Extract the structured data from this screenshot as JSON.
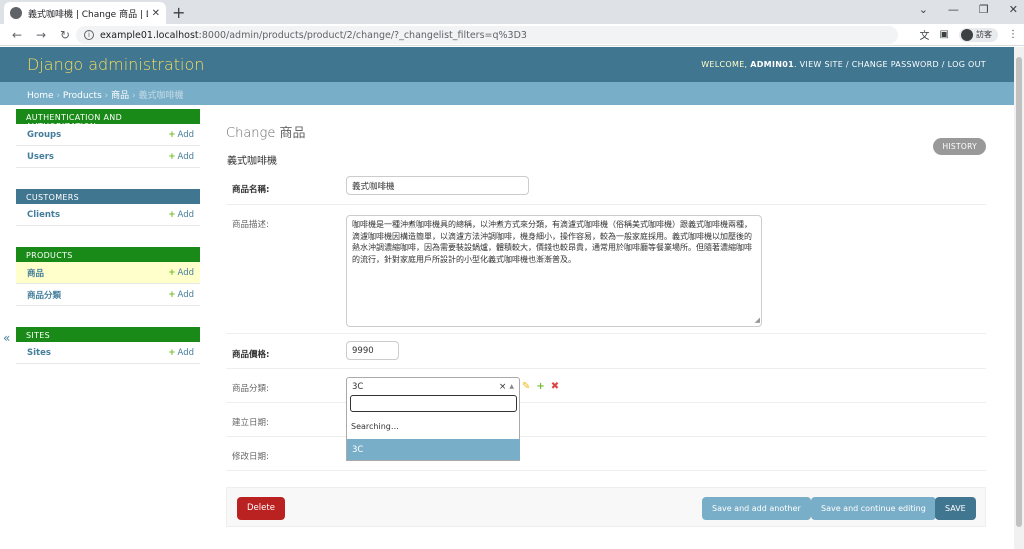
{
  "browser": {
    "tab_title": "義式咖啡機 | Change 商品 | Djan",
    "tab_close": "✕",
    "new_tab": "+",
    "url_host": "example01.localhost",
    "url_rest": ":8000/admin/products/product/2/change/?_changelist_filters=q%3D3",
    "profile_label": "訪客"
  },
  "header": {
    "brand": "Django administration",
    "welcome": "WELCOME, ",
    "username": "ADMIN01",
    "links": ". VIEW SITE / CHANGE PASSWORD / LOG OUT"
  },
  "breadcrumbs": {
    "home": "Home",
    "app": "Products",
    "model": "商品",
    "current": "義式咖啡機",
    "sep": " › "
  },
  "sidebar": {
    "add_label": "Add",
    "modules": [
      {
        "caption": "AUTHENTICATION AND AUTHORIZATION",
        "rows": [
          "Groups",
          "Users"
        ]
      },
      {
        "caption": "CUSTOMERS",
        "rows": [
          "Clients"
        ]
      },
      {
        "caption": "PRODUCTS",
        "rows": [
          "商品",
          "商品分類"
        ]
      },
      {
        "caption": "SITES",
        "rows": [
          "Sites"
        ]
      }
    ],
    "toggle": "«"
  },
  "content": {
    "page_title": "Change 商品",
    "object_title": "義式咖啡機",
    "history": "HISTORY",
    "fields": {
      "name_label": "商品名稱:",
      "name_value": "義式咖啡機",
      "desc_label": "商品描述:",
      "desc_value": "咖啡機是一種沖煮咖啡機具的總稱，以沖煮方式來分類，有滴濾式咖啡機（俗稱美式咖啡機）跟義式咖啡機兩種，滴濾咖啡機因構造簡單，以滴濾方法沖調咖啡，機身細小，操作容易，較為一般家庭採用。義式咖啡機以加壓後的熱水沖調濃縮咖啡，因為需要裝設鍋爐，體積較大，價錢也較昂貴，通常用於咖啡廳等餐業場所。但隨著濃縮咖啡的流行，針對家庭用戶所設計的小型化義式咖啡機也漸漸普及。",
      "price_label": "商品價格:",
      "price_value": "9990",
      "category_label": "商品分類:",
      "category_value": "3C",
      "created_label": "建立日期:",
      "modified_label": "修改日期:"
    },
    "dropdown": {
      "searching": "Searching…",
      "option": "3C"
    }
  },
  "submit": {
    "delete": "Delete",
    "save_add": "Save and add another",
    "save_continue": "Save and continue editing",
    "save": "SAVE"
  }
}
